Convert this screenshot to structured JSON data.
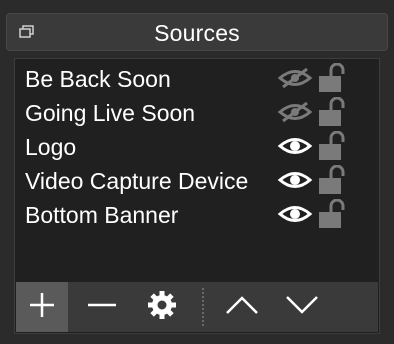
{
  "dock": {
    "title": "Sources"
  },
  "sources": [
    {
      "label": "Be Back Soon",
      "visible": false,
      "locked": false
    },
    {
      "label": "Going Live Soon",
      "visible": false,
      "locked": false
    },
    {
      "label": "Logo",
      "visible": true,
      "locked": false
    },
    {
      "label": "Video Capture Device",
      "visible": true,
      "locked": false
    },
    {
      "label": "Bottom Banner",
      "visible": true,
      "locked": false
    }
  ],
  "toolbar": {
    "buttons": [
      "plus-icon",
      "minus-icon",
      "gear-icon",
      "chevron-up-icon",
      "chevron-down-icon"
    ]
  },
  "colors": {
    "icon_visible": "#ffffff",
    "icon_hidden": "#7a7a7a",
    "panel_bg": "#202020",
    "toolbar_bg": "#3a3a3a",
    "active_button_bg": "#5a5a5a"
  }
}
